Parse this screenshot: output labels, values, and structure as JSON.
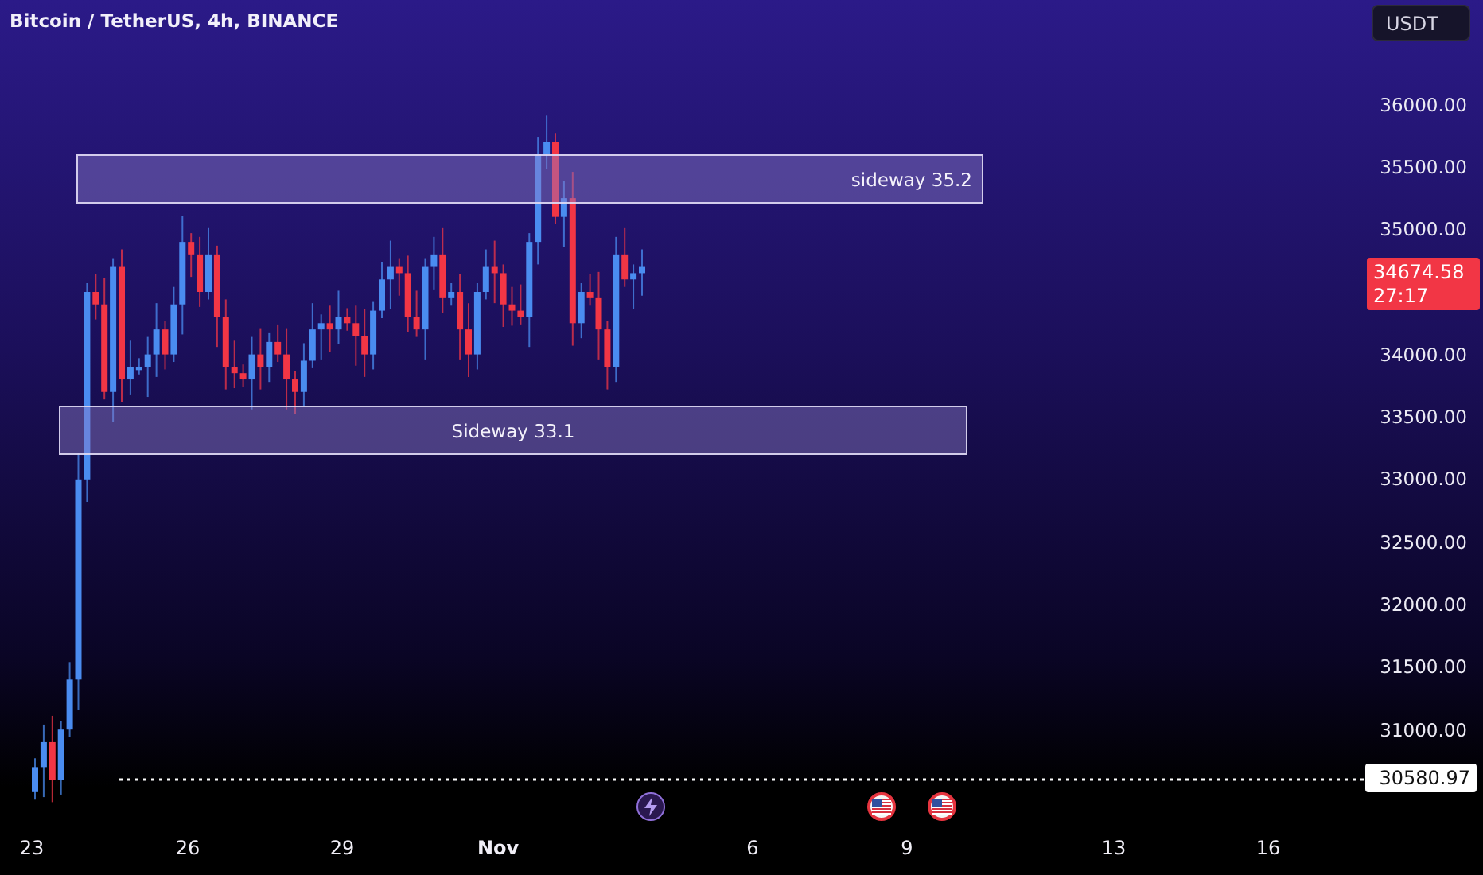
{
  "chart_title": "Bitcoin / TetherUS, 4h, BINANCE",
  "currency_button": "USDT",
  "price_axis": {
    "labels": [
      "36000.00",
      "35500.00",
      "35000.00",
      "34000.00",
      "33500.00",
      "33000.00",
      "32500.00",
      "32000.00",
      "31500.00",
      "31000.00"
    ]
  },
  "last_price": {
    "value": "34674.58",
    "countdown": "27:17"
  },
  "marked_price": "30580.97",
  "zones": [
    {
      "label": "sideway 35.2"
    },
    {
      "label": "Sideway 33.1"
    }
  ],
  "events": [
    {
      "kind": "lightning"
    },
    {
      "kind": "flag"
    },
    {
      "kind": "flag"
    }
  ],
  "time_axis": [
    {
      "label": "23",
      "bold": false
    },
    {
      "label": "26",
      "bold": false
    },
    {
      "label": "29",
      "bold": false
    },
    {
      "label": "Nov",
      "bold": true
    },
    {
      "label": "6",
      "bold": false
    },
    {
      "label": "9",
      "bold": false
    },
    {
      "label": "13",
      "bold": false
    },
    {
      "label": "16",
      "bold": false
    }
  ]
}
